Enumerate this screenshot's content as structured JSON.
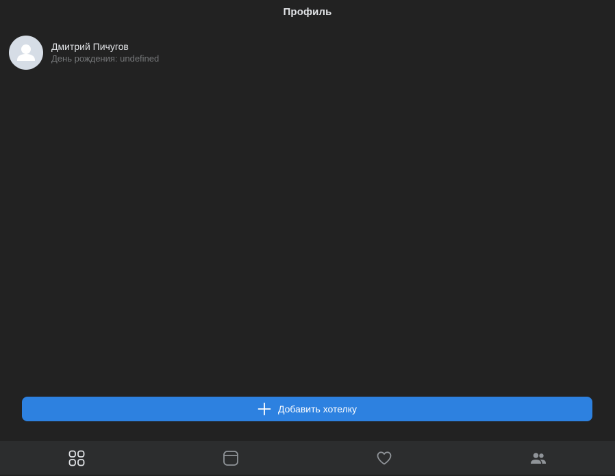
{
  "header": {
    "title": "Профиль"
  },
  "profile": {
    "name": "Дмитрий Пичугов",
    "birthday": "День рождения: undefined",
    "avatar_icon": "user-placeholder-icon"
  },
  "actions": {
    "add_wish_label": "Добавить хотелку",
    "add_icon": "plus-icon"
  },
  "tabbar": {
    "tabs": [
      {
        "id": "grid",
        "icon": "grid-icon",
        "active": true
      },
      {
        "id": "window",
        "icon": "window-icon",
        "active": false
      },
      {
        "id": "favorites",
        "icon": "heart-icon",
        "active": false
      },
      {
        "id": "friends",
        "icon": "users-icon",
        "active": false
      }
    ]
  },
  "colors": {
    "background": "#222222",
    "tabbar": "#2c2d2e",
    "accent": "#2d81e0",
    "text_primary": "#e1e3e6",
    "text_secondary": "#76787a",
    "icon_active": "#e1e3e6",
    "icon_inactive": "#909499"
  }
}
